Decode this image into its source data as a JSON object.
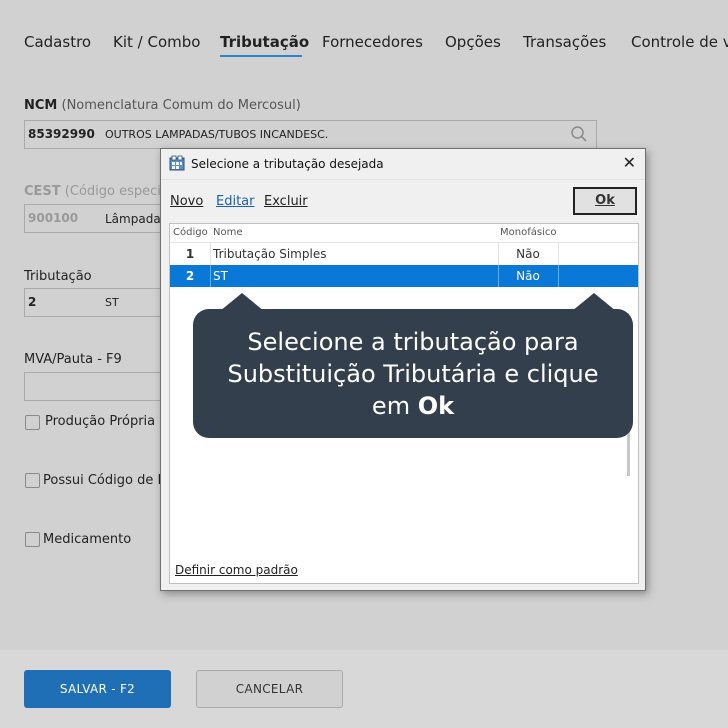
{
  "tabs": [
    "Cadastro",
    "Kit / Combo",
    "Tributação",
    "Fornecedores",
    "Opções",
    "Transações",
    "Controle de v"
  ],
  "ncm": {
    "label": "NCM",
    "hint": "(Nomenclatura Comum do Mercosul)",
    "code": "85392990",
    "description": "OUTROS LAMPADAS/TUBOS INCANDESC."
  },
  "cest": {
    "label": "CEST",
    "hint": "(Código especif",
    "code": "900100",
    "description": "Lâmpada"
  },
  "tributacao": {
    "label": "Tributação",
    "code": "2",
    "description": "ST"
  },
  "mva": {
    "label": "MVA/Pauta - F9"
  },
  "checkboxes": {
    "producao": "Produção Própria",
    "beneficio": "Possui Código de Be",
    "medicamento": "Medicamento"
  },
  "footer": {
    "save": "SALVAR - F2",
    "cancel": "CANCELAR"
  },
  "dialog": {
    "title": "Selecione a tributação desejada",
    "close": "✕",
    "toolbar": {
      "novo": "Novo",
      "editar": "Editar",
      "excluir": "Excluir",
      "ok": "Ok"
    },
    "columns": {
      "codigo": "Código",
      "nome": "Nome",
      "monofasico": "Monofásico"
    },
    "rows": [
      {
        "codigo": "1",
        "nome": "Tributação Simples",
        "monofasico": "Não"
      },
      {
        "codigo": "2",
        "nome": "ST",
        "monofasico": "Não"
      }
    ],
    "selected_row": 2,
    "default_link": "Definir como padrão"
  },
  "tooltip": {
    "line1": "Selecione a tributação para",
    "line2": "Substituição Tributária e clique",
    "line3_prefix": "em ",
    "line3_bold": "Ok"
  },
  "colors": {
    "accent": "#2f83c9",
    "selection": "#0a78d6",
    "primary_button": "#1f6fb6",
    "tooltip_bg": "#343f4d"
  }
}
